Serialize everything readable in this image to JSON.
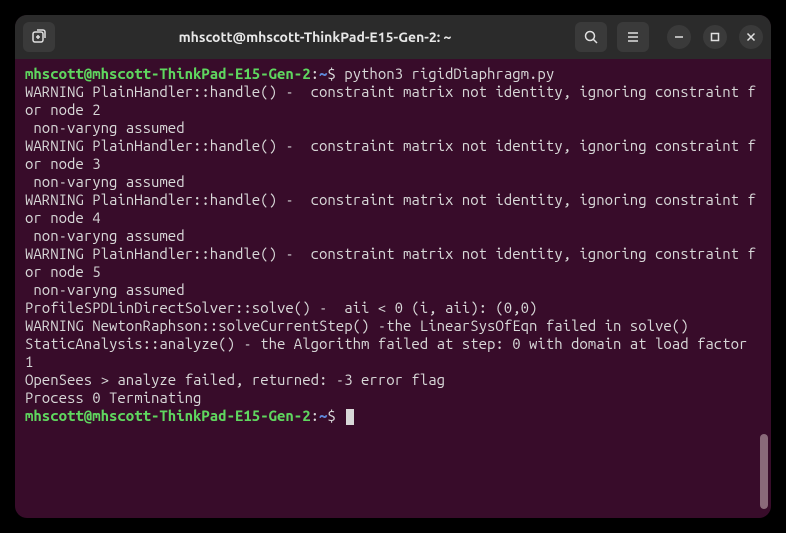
{
  "title": "mhscott@mhscott-ThinkPad-E15-Gen-2: ~",
  "prompt": {
    "user": "mhscott@mhscott-ThinkPad-E15-Gen-2",
    "colon": ":",
    "path": "~",
    "dollar": "$ "
  },
  "command1": "python3 rigidDiaphragm.py",
  "output": [
    "WARNING PlainHandler::handle() -  constraint matrix not identity, ignoring constraint for node 2",
    " non-varyng assumed",
    "WARNING PlainHandler::handle() -  constraint matrix not identity, ignoring constraint for node 3",
    " non-varyng assumed",
    "WARNING PlainHandler::handle() -  constraint matrix not identity, ignoring constraint for node 4",
    " non-varyng assumed",
    "WARNING PlainHandler::handle() -  constraint matrix not identity, ignoring constraint for node 5",
    " non-varyng assumed",
    "ProfileSPDLinDirectSolver::solve() -  aii < 0 (i, aii): (0,0)",
    "WARNING NewtonRaphson::solveCurrentStep() -the LinearSysOfEqn failed in solve()",
    "StaticAnalysis::analyze() - the Algorithm failed at step: 0 with domain at load factor 1",
    "OpenSees > analyze failed, returned: -3 error flag",
    "Process 0 Terminating"
  ]
}
